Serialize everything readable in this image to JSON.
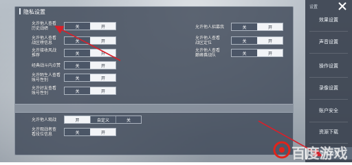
{
  "panel": {
    "title": "隐私设置"
  },
  "settings_top_left": [
    {
      "label": "允许他人查看\n历史战绩",
      "options": [
        "关",
        "开"
      ],
      "selected": 1
    },
    {
      "label": "允许他人查看\n战区榜信息",
      "options": [
        "关",
        "开"
      ],
      "selected": 1
    },
    {
      "label": "允许接收风战\n推荐",
      "options": [
        "关",
        "开"
      ],
      "selected": 1
    },
    {
      "label": "经典战斗内点赞",
      "options": [
        "关",
        "开"
      ],
      "selected": 1
    },
    {
      "label": "允许陌生人查看\n账号性别",
      "options": [
        "关",
        "开"
      ],
      "selected": 1
    },
    {
      "label": "允许好友查看\n账号性别",
      "options": [
        "关",
        "开"
      ],
      "selected": 1
    }
  ],
  "settings_top_right": [
    {
      "label": "允许他人招募我",
      "options": [
        "关",
        "开"
      ],
      "selected": 1
    },
    {
      "label": "允许他人查看\n战区定位",
      "options": [
        "关",
        "开"
      ],
      "selected": 1
    },
    {
      "label": "允许他人查看\n巅峰赛战队",
      "options": [
        "关",
        "开"
      ],
      "selected": 1
    }
  ],
  "settings_bottom": [
    {
      "label": "允许他人观战",
      "options": [
        "开",
        "自定义",
        "关"
      ],
      "selected": 0
    },
    {
      "label": "允许观战者查\n看段位信息",
      "options": [
        "关",
        "开"
      ],
      "selected": 1
    }
  ],
  "side_menu": {
    "header": "设置",
    "items": [
      "效果设置",
      "声音设置",
      "操作设置",
      "录像设置",
      "账户安全",
      "资源下载",
      "隐私设置"
    ],
    "selected_index": 6
  },
  "watermark": {
    "text": "百度游戏"
  },
  "colors": {
    "arrow": "#d9202a",
    "watermark_red": "#e2231a",
    "active_segment": "#f2f4f7"
  }
}
